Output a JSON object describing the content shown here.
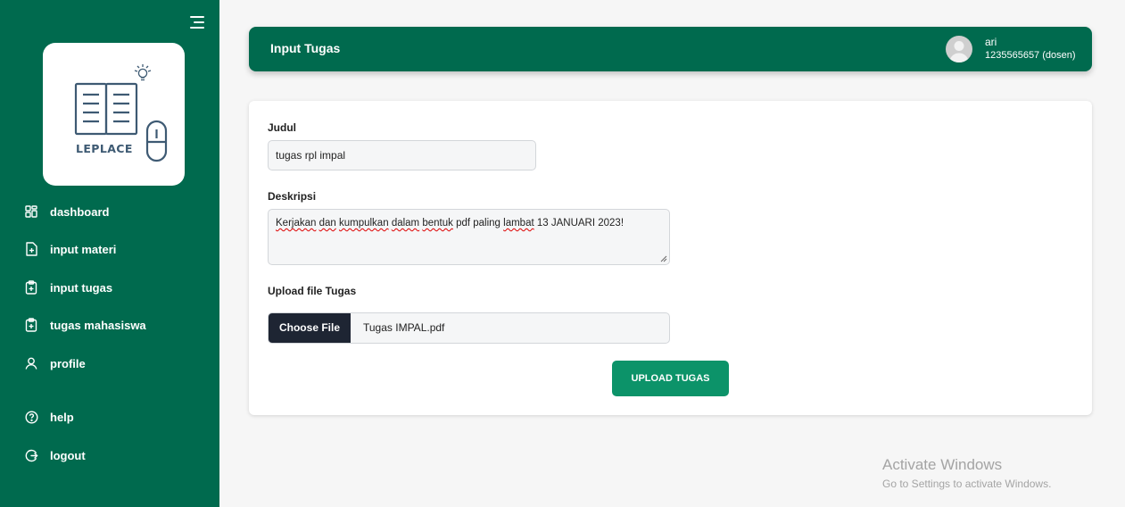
{
  "brand": {
    "logo_text": "LEPLACE"
  },
  "colors": {
    "primary": "#006a4e",
    "button": "#0c9369",
    "file_button": "#1e2533",
    "page_bg": "#f6f6f6"
  },
  "sidebar": {
    "items": [
      {
        "label": "dashboard",
        "icon": "dashboard-grid-icon"
      },
      {
        "label": "input materi",
        "icon": "file-plus-icon"
      },
      {
        "label": "input tugas",
        "icon": "clipboard-plus-icon"
      },
      {
        "label": "tugas mahasiswa",
        "icon": "clipboard-plus-icon"
      },
      {
        "label": "profile",
        "icon": "user-icon"
      },
      {
        "label": "help",
        "icon": "help-circle-icon"
      },
      {
        "label": "logout",
        "icon": "logout-icon"
      }
    ]
  },
  "header": {
    "title": "Input Tugas",
    "user_name": "ari",
    "user_id": "1235565657 (dosen)"
  },
  "form": {
    "judul_label": "Judul",
    "judul_value": "tugas rpl impal",
    "deskripsi_label": "Deskripsi",
    "deskripsi_value": [
      {
        "text": "Kerjakan",
        "flag": true
      },
      {
        "text": " ",
        "flag": false
      },
      {
        "text": "dan",
        "flag": true
      },
      {
        "text": " ",
        "flag": false
      },
      {
        "text": "kumpulkan",
        "flag": true
      },
      {
        "text": " ",
        "flag": false
      },
      {
        "text": "dalam",
        "flag": true
      },
      {
        "text": " ",
        "flag": false
      },
      {
        "text": "bentuk",
        "flag": true
      },
      {
        "text": " pdf paling ",
        "flag": false
      },
      {
        "text": "lambat",
        "flag": true
      },
      {
        "text": " 13 JANUARI 2023!",
        "flag": false
      }
    ],
    "upload_label": "Upload file Tugas",
    "choose_file_label": "Choose File",
    "file_name": "Tugas IMPAL.pdf",
    "submit_label": "UPLOAD TUGAS"
  },
  "watermark": {
    "line1": "Activate Windows",
    "line2": "Go to Settings to activate Windows."
  }
}
